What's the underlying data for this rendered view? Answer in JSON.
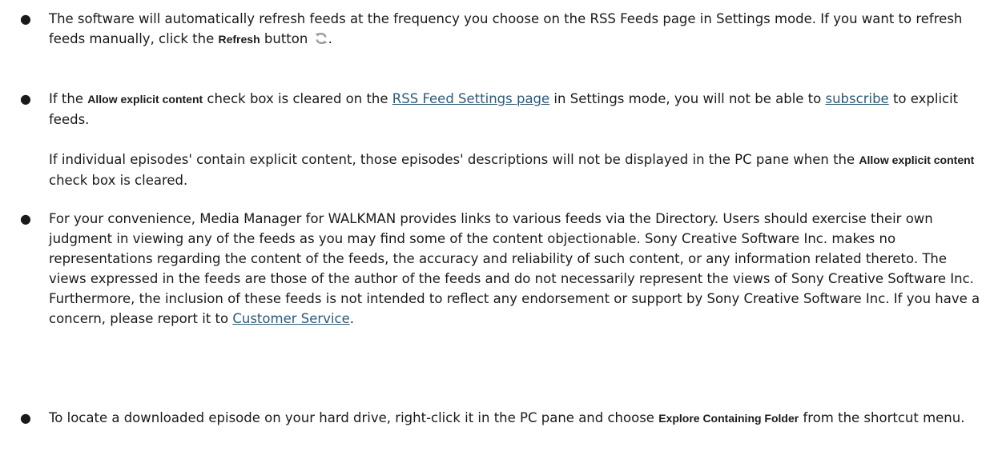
{
  "bullet_char": "●",
  "items": [
    {
      "p1": {
        "t1": "The software will automatically refresh feeds at the frequency you choose on the RSS Feeds page in Settings mode. If you want to refresh feeds manually, click the ",
        "b1": "Refresh",
        "t2": " button ",
        "icon": "refresh-icon",
        "t3": "."
      }
    },
    {
      "p1": {
        "t1": "If the ",
        "b1": "Allow explicit content",
        "t2": " check box is cleared on the ",
        "link1": "RSS Feed Settings page",
        "t3": " in Settings mode, you will not be able to ",
        "link2": "subscribe",
        "t4": " to explicit feeds."
      },
      "p2": {
        "t1": "If individual episodes' contain explicit content, those episodes' descriptions will not be displayed in the PC pane when the ",
        "b1": "Allow explicit content",
        "t2": " check box is cleared."
      }
    },
    {
      "p1": {
        "t1": "For your convenience, Media Manager for WALKMAN provides links to various feeds via the Directory. Users should exercise their own judgment in viewing any of the feeds as you may find some of the content objectionable. Sony Creative Software Inc. makes no representations regarding the content of the feeds, the accuracy and reliability of such content, or any information related thereto. The views expressed in the feeds are those of the author of the feeds and do not necessarily represent the views of Sony Creative Software Inc. Furthermore, the inclusion of these feeds is not intended to reflect any endorsement or support by Sony Creative Software Inc. If you have a concern, please report it to ",
        "link1": "Customer Service",
        "t2": "."
      }
    },
    {
      "p1": {
        "t1": "To locate a downloaded episode on your hard drive, right-click it in the PC pane and choose ",
        "b1": "Explore Containing Folder",
        "t2": " from the shortcut menu."
      }
    }
  ],
  "colors": {
    "text": "#1a1a1a",
    "link": "#2c5a78",
    "icon": "#9a9a9a"
  }
}
